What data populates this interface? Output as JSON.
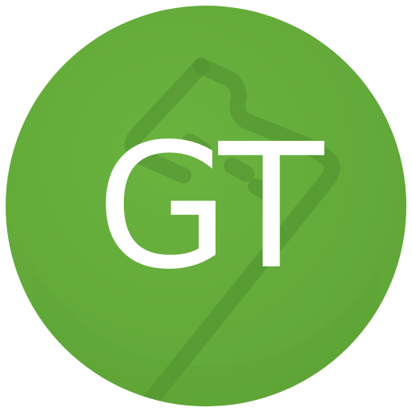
{
  "icon": {
    "monogram": "GT",
    "name": "gt-app-icon",
    "background_icon": "watermark-icon",
    "colors": {
      "circle": "#65AC3B",
      "circle_shade": "#5FA637",
      "watermark": "#4F8F2F",
      "text": "#FFFFFF"
    }
  }
}
